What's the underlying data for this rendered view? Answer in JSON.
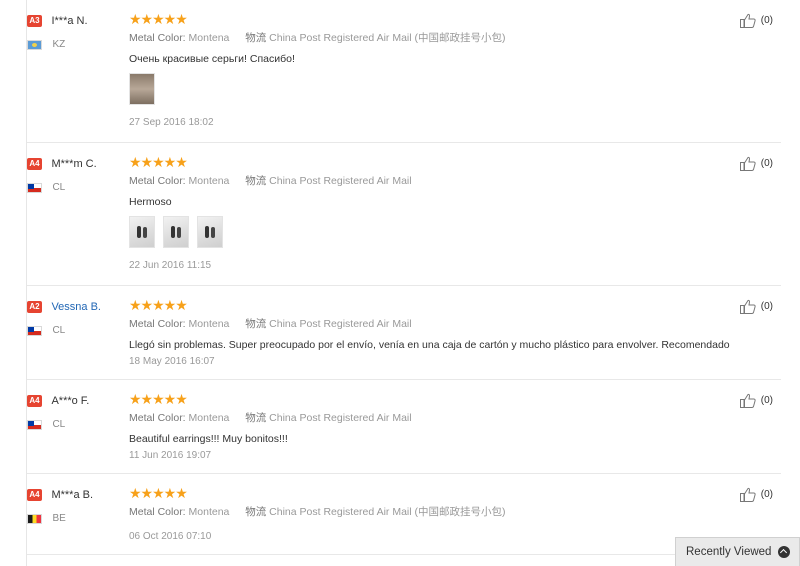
{
  "reviews": [
    {
      "level": "A3",
      "name": "I***a N.",
      "name_is_link": false,
      "country_code": "KZ",
      "flag": "kz",
      "stars": 5,
      "metal_label": "Metal Color:",
      "metal_value": "Montena",
      "shipping_label": "物流",
      "shipping_value": "China Post Registered Air Mail (中国邮政挂号小包)",
      "text": "Очень красивые серьги! Спасибо!",
      "photos": 1,
      "date": "27 Sep 2016 18:02",
      "helpful": "(0)"
    },
    {
      "level": "A4",
      "name": "M***m C.",
      "name_is_link": false,
      "country_code": "CL",
      "flag": "cl",
      "stars": 5,
      "metal_label": "Metal Color:",
      "metal_value": "Montena",
      "shipping_label": "物流",
      "shipping_value": "China Post Registered Air Mail",
      "text": "Hermoso",
      "photos": 3,
      "date": "22 Jun 2016 11:15",
      "helpful": "(0)"
    },
    {
      "level": "A2",
      "name": "Vessna B.",
      "name_is_link": true,
      "country_code": "CL",
      "flag": "cl",
      "stars": 5,
      "metal_label": "Metal Color:",
      "metal_value": "Montena",
      "shipping_label": "物流",
      "shipping_value": "China Post Registered Air Mail",
      "text": "Llegó sin problemas. Super preocupado por el envío, venía en una caja de cartón y mucho plástico para envolver. Recomendado",
      "photos": 0,
      "date": "18 May 2016 16:07",
      "helpful": "(0)"
    },
    {
      "level": "A4",
      "name": "A***o F.",
      "name_is_link": false,
      "country_code": "CL",
      "flag": "cl",
      "stars": 5,
      "metal_label": "Metal Color:",
      "metal_value": "Montena",
      "shipping_label": "物流",
      "shipping_value": "China Post Registered Air Mail",
      "text": "Beautiful earrings!!! Muy bonitos!!!",
      "photos": 0,
      "date": "11 Jun 2016 19:07",
      "helpful": "(0)"
    },
    {
      "level": "A4",
      "name": "M***a B.",
      "name_is_link": false,
      "country_code": "BE",
      "flag": "be",
      "stars": 5,
      "metal_label": "Metal Color:",
      "metal_value": "Montena",
      "shipping_label": "物流",
      "shipping_value": "China Post Registered Air Mail (中国邮政挂号小包)",
      "text": "",
      "photos": 0,
      "date": "06 Oct 2016 07:10",
      "helpful": "(0)"
    }
  ],
  "recently_viewed": {
    "label": "Recently Viewed"
  },
  "colors": {
    "star": "#f7a11a",
    "badge": "#e64431",
    "link": "#2267b5"
  }
}
